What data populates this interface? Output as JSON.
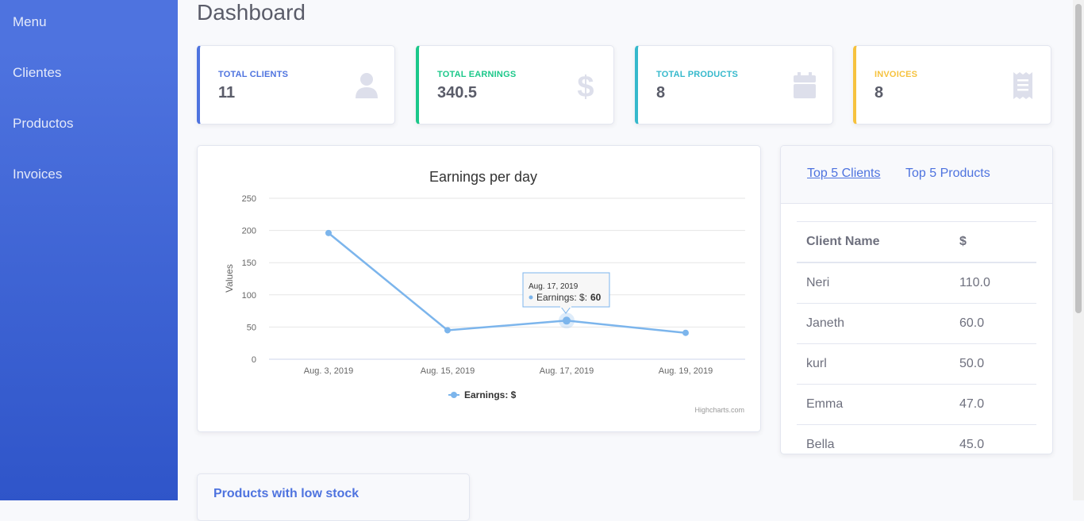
{
  "sidebar": {
    "items": [
      {
        "label": "Menu"
      },
      {
        "label": "Clientes"
      },
      {
        "label": "Productos"
      },
      {
        "label": "Invoices"
      }
    ]
  },
  "page": {
    "title": "Dashboard"
  },
  "cards": [
    {
      "label": "TOTAL CLIENTS",
      "value": "11",
      "color": "#4e73df",
      "icon": "user-icon"
    },
    {
      "label": "TOTAL EARNINGS",
      "value": "340.5",
      "color": "#1cc88a",
      "icon": "dollar-icon"
    },
    {
      "label": "TOTAL PRODUCTS",
      "value": "8",
      "color": "#36b9cc",
      "icon": "calendar-icon"
    },
    {
      "label": "INVOICES",
      "value": "8",
      "color": "#f6c23e",
      "icon": "receipt-icon"
    }
  ],
  "chart_data": {
    "type": "line",
    "title": "Earnings per day",
    "ylabel": "Values",
    "xlabel": "",
    "categories": [
      "Aug. 3, 2019",
      "Aug. 15, 2019",
      "Aug. 17, 2019",
      "Aug. 19, 2019"
    ],
    "series": [
      {
        "name": "Earnings: $",
        "values": [
          196,
          45,
          60,
          41
        ],
        "color": "#7cb5ec"
      }
    ],
    "ylim": [
      0,
      250
    ],
    "yticks": [
      0,
      50,
      100,
      150,
      200,
      250
    ],
    "grid": true,
    "legend": "bottom-center",
    "tooltip": {
      "header": "Aug. 17, 2019",
      "label": "Earnings: $:",
      "value": "60"
    },
    "credits": "Highcharts.com"
  },
  "top": {
    "tabs": [
      {
        "label": "Top 5 Clients"
      },
      {
        "label": "Top 5 Products"
      }
    ],
    "columns": {
      "name": "Client Name",
      "amount": "$"
    },
    "rows": [
      {
        "name": "Neri",
        "amount": "110.0"
      },
      {
        "name": "Janeth",
        "amount": "60.0"
      },
      {
        "name": "kurl",
        "amount": "50.0"
      },
      {
        "name": "Emma",
        "amount": "47.0"
      },
      {
        "name": "Bella",
        "amount": "45.0"
      }
    ]
  },
  "low_stock": {
    "title": "Products with low stock"
  },
  "colors": {
    "sidebar": "#4e73df",
    "background": "#f8f9fc"
  }
}
